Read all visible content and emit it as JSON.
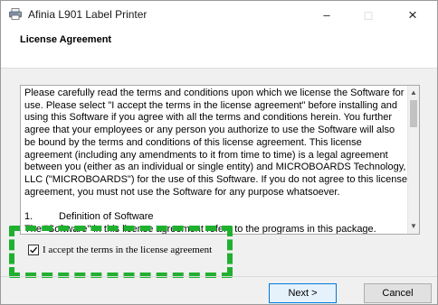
{
  "window": {
    "title": "Afinia L901 Label Printer",
    "controls": {
      "minimize": "–",
      "maximize": "□",
      "close": "×"
    }
  },
  "header": {
    "title": "License Agreement"
  },
  "license": {
    "paragraph": "Please carefully read the terms and conditions upon which we license the Software for use. Please select \"I accept the terms in the license agreement\" before installing and using this Software if you agree with all the terms and conditions herein.  You further agree that your employees or any person you authorize to use the Software will also be bound by the terms and conditions of this license agreement.  This license agreement (including any amendments to it from time to time) is a legal agreement between you (either as an individual or single entity) and MICROBOARDS Technology, LLC (\"MICROBOARDS\") for the use of this Software.  If you do not agree to this license agreement, you must not use the Software for any purpose whatsoever.",
    "section_number": "1.",
    "section_title": "Definition of Software",
    "section_text": "The \"Software\" in this license agreement refers to the programs in this package."
  },
  "accept": {
    "label": "I accept the terms in the license agreement",
    "checked": true
  },
  "buttons": {
    "next": "Next >",
    "cancel": "Cancel"
  },
  "icons": {
    "app": "printer-icon",
    "scroll_up": "scroll-up-arrow-icon",
    "scroll_down": "scroll-down-arrow-icon",
    "check": "checkmark-icon"
  },
  "colors": {
    "highlight": "#20b030",
    "primary_button_border": "#0078d7",
    "primary_button_fill": "#e5f1fb"
  }
}
